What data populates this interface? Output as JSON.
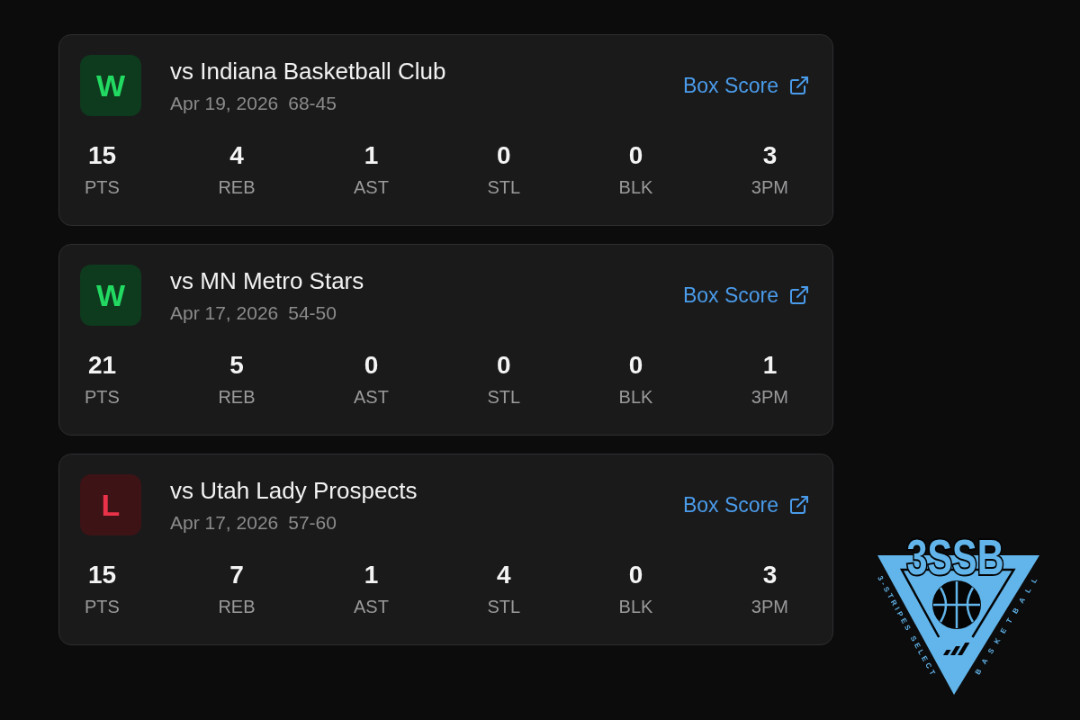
{
  "games": [
    {
      "kind": "win",
      "result": "W",
      "opponent": "vs Indiana Basketball Club",
      "date": "Apr 19, 2026",
      "score": "68-45",
      "link": "Box Score",
      "stats": [
        {
          "value": "15",
          "label": "PTS"
        },
        {
          "value": "4",
          "label": "REB"
        },
        {
          "value": "1",
          "label": "AST"
        },
        {
          "value": "0",
          "label": "STL"
        },
        {
          "value": "0",
          "label": "BLK"
        },
        {
          "value": "3",
          "label": "3PM"
        }
      ]
    },
    {
      "kind": "win",
      "result": "W",
      "opponent": "vs MN Metro Stars",
      "date": "Apr 17, 2026",
      "score": "54-50",
      "link": "Box Score",
      "stats": [
        {
          "value": "21",
          "label": "PTS"
        },
        {
          "value": "5",
          "label": "REB"
        },
        {
          "value": "0",
          "label": "AST"
        },
        {
          "value": "0",
          "label": "STL"
        },
        {
          "value": "0",
          "label": "BLK"
        },
        {
          "value": "1",
          "label": "3PM"
        }
      ]
    },
    {
      "kind": "loss",
      "result": "L",
      "opponent": "vs Utah Lady Prospects",
      "date": "Apr 17, 2026",
      "score": "57-60",
      "link": "Box Score",
      "stats": [
        {
          "value": "15",
          "label": "PTS"
        },
        {
          "value": "7",
          "label": "REB"
        },
        {
          "value": "1",
          "label": "AST"
        },
        {
          "value": "4",
          "label": "STL"
        },
        {
          "value": "0",
          "label": "BLK"
        },
        {
          "value": "3",
          "label": "3PM"
        }
      ]
    }
  ],
  "logo": {
    "title": "3SSB",
    "left_text": "3-STRIPES SELECT",
    "right_text": "BASKETBALL"
  }
}
